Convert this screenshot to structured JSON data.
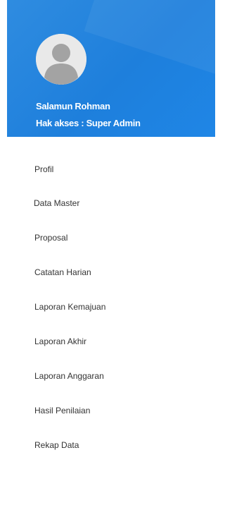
{
  "user": {
    "name": "Salamun Rohman",
    "role": "Hak akses : Super Admin"
  },
  "menu": {
    "items": [
      {
        "label": "Profil"
      },
      {
        "label": "Data Master"
      },
      {
        "label": "Proposal"
      },
      {
        "label": "Catatan Harian"
      },
      {
        "label": "Laporan Kemajuan"
      },
      {
        "label": "Laporan Akhir"
      },
      {
        "label": "Laporan Anggaran"
      },
      {
        "label": "Hasil Penilaian"
      },
      {
        "label": "Rekap Data"
      }
    ]
  },
  "colors": {
    "header_bg": "#1e7fdc",
    "header_text": "#ffffff",
    "menu_text": "#333333",
    "avatar_bg": "#e9e9e9",
    "avatar_fg": "#a3a3a3"
  },
  "icons": {
    "avatar": "user-silhouette-icon"
  }
}
